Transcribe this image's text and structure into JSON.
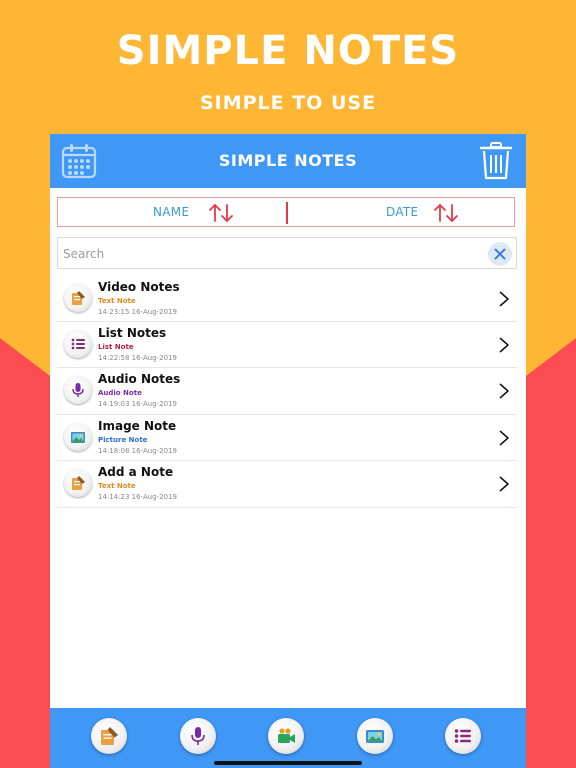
{
  "promo": {
    "title": "SIMPLE NOTES",
    "subtitle": "SIMPLE TO USE"
  },
  "app": {
    "title": "SIMPLE NOTES",
    "icons": {
      "left": "calendar-icon",
      "right": "trash-icon"
    }
  },
  "sort": {
    "name_label": "NAME",
    "date_label": "DATE"
  },
  "search": {
    "placeholder": "Search",
    "value": ""
  },
  "notes": [
    {
      "title": "Video Notes",
      "type": "Text Note",
      "timestamp": "14:23:15 16-Aug-2019",
      "icon": "text-note-icon",
      "type_color": "#e08a1e"
    },
    {
      "title": "List Notes",
      "type": "List Note",
      "timestamp": "14:22:58 16-Aug-2019",
      "icon": "list-note-icon",
      "type_color": "#b0224e"
    },
    {
      "title": "Audio Notes",
      "type": "Audio Note",
      "timestamp": "14:19:03 16-Aug-2019",
      "icon": "audio-note-icon",
      "type_color": "#7a2aa8"
    },
    {
      "title": "Image Note",
      "type": "Picture Note",
      "timestamp": "14:18:08 16-Aug-2019",
      "icon": "picture-note-icon",
      "type_color": "#2b6fd6"
    },
    {
      "title": "Add a Note",
      "type": "Text Note",
      "timestamp": "14:14:23 16-Aug-2019",
      "icon": "text-note-icon",
      "type_color": "#e08a1e"
    }
  ],
  "bottom_tabs": [
    {
      "icon": "text-note-icon"
    },
    {
      "icon": "microphone-icon"
    },
    {
      "icon": "video-camera-icon"
    },
    {
      "icon": "picture-icon"
    },
    {
      "icon": "list-icon"
    }
  ],
  "colors": {
    "background_top": "#ffb635",
    "background_bottom": "#fb4c52",
    "accent_blue": "#3f97f6",
    "sort_arrow_red": "#e23a47",
    "sort_label_blue": "#3a9ad6"
  }
}
